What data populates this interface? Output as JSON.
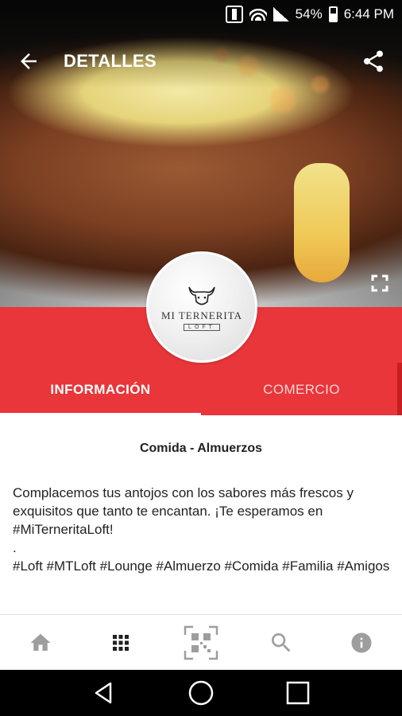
{
  "status_bar": {
    "battery": "54%",
    "time": "6:44 PM"
  },
  "app_bar": {
    "title": "DETALLES"
  },
  "logo": {
    "name": "MI TERNERITA",
    "sub": "LOFT"
  },
  "tabs": [
    {
      "label": "INFORMACIÓN",
      "active": true
    },
    {
      "label": "COMERCIO",
      "active": false
    }
  ],
  "content": {
    "category": "Comida - Almuerzos",
    "paragraphs": [
      "Complacemos tus antojos con los sabores más frescos y exquisitos que tanto te encantan. ¡Te esperamos en #MiTerneritaLoft!",
      ".",
      "#Loft #MTLoft #Lounge #Almuerzo #Comida #Familia #Amigos"
    ]
  },
  "bottom_nav": [
    {
      "icon": "home-icon"
    },
    {
      "icon": "grid-icon"
    },
    {
      "icon": "qr-code-icon"
    },
    {
      "icon": "search-icon"
    },
    {
      "icon": "info-icon"
    }
  ],
  "colors": {
    "accent": "#e8363a",
    "nav_icon": "#9e9e9e",
    "active_nav_icon": "#212121"
  }
}
